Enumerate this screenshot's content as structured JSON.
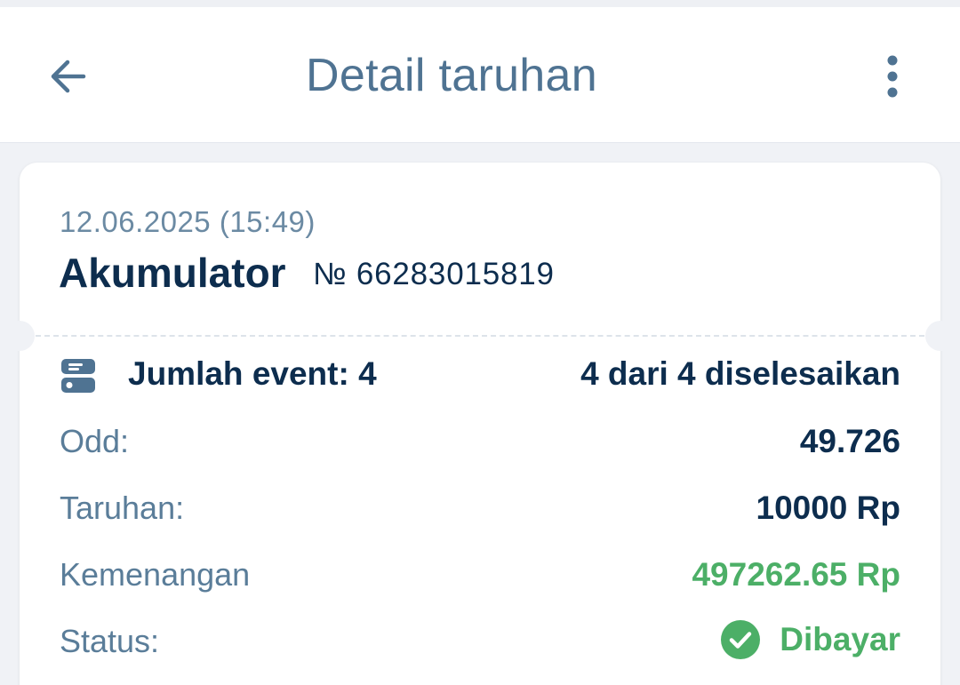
{
  "header": {
    "title": "Detail taruhan",
    "back_icon": "arrow-left-icon",
    "menu_icon": "more-vertical-icon"
  },
  "bet": {
    "date": "12.06.2025 (15:49)",
    "type": "Akumulator",
    "number": "№ 66283015819",
    "events_icon": "events-list-icon",
    "events_label": "Jumlah event: 4",
    "events_settled": "4 dari 4 diselesaikan",
    "odd_label": "Odd:",
    "odd_value": "49.726",
    "stake_label": "Taruhan:",
    "stake_value": "10000 Rp",
    "winnings_label": "Kemenangan",
    "winnings_value": "497262.65 Rp",
    "status_label": "Status:",
    "status_value": "Dibayar",
    "status_icon": "check-circle-icon"
  },
  "colors": {
    "title": "#4f7392",
    "primary_text": "#0d2d4e",
    "secondary_text": "#5a7d99",
    "success": "#4caf67",
    "background": "#f0f2f6"
  }
}
